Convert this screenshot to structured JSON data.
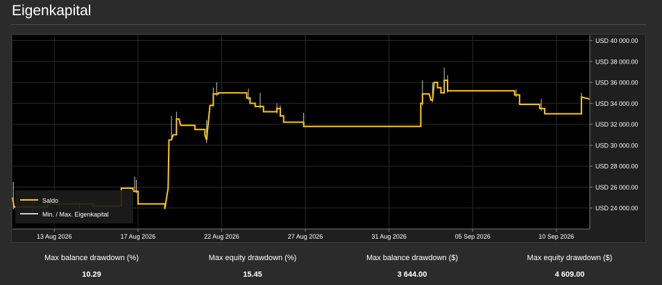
{
  "page": {
    "title": "Eigenkapital"
  },
  "chart_data": {
    "type": "line",
    "title": "Eigenkapital",
    "x_ticks": [
      "13 Aug 2026",
      "17 Aug 2026",
      "22 Aug 2026",
      "27 Aug 2026",
      "31 Aug 2026",
      "05 Sep 2026",
      "10 Sep 2026"
    ],
    "y_ticks": [
      "USD 24 000.00",
      "USD 26 000.00",
      "USD 28 000.00",
      "USD 30 000.00",
      "USD 32 000.00",
      "USD 34 000.00",
      "USD 36 000.00",
      "USD 38 000.00",
      "USD 40 000.00"
    ],
    "ylim": [
      22000,
      40500
    ],
    "xlim": [
      0,
      34.5
    ],
    "grid": true,
    "legend_position": "bottom-left",
    "series": [
      {
        "name": "Saldo",
        "color": "#ffcc00",
        "points": [
          [
            0,
            25000
          ],
          [
            0.1,
            24100
          ],
          [
            2.1,
            24100
          ],
          [
            2.1,
            24400
          ],
          [
            4.8,
            24400
          ],
          [
            4.8,
            24200
          ],
          [
            6.5,
            24200
          ],
          [
            6.5,
            25900
          ],
          [
            7.2,
            25900
          ],
          [
            7.2,
            25600
          ],
          [
            7.5,
            25600
          ],
          [
            7.5,
            24400
          ],
          [
            9.1,
            24400
          ],
          [
            9.1,
            23900
          ],
          [
            9.3,
            25900
          ],
          [
            9.35,
            30500
          ],
          [
            9.5,
            30500
          ],
          [
            9.6,
            31000
          ],
          [
            9.8,
            31000
          ],
          [
            9.8,
            32500
          ],
          [
            9.95,
            32500
          ],
          [
            10.05,
            31900
          ],
          [
            10.9,
            31900
          ],
          [
            10.9,
            31500
          ],
          [
            11.5,
            31500
          ],
          [
            11.5,
            31000
          ],
          [
            11.6,
            30500
          ],
          [
            11.7,
            32200
          ],
          [
            11.8,
            33800
          ],
          [
            12.0,
            33800
          ],
          [
            12.0,
            34900
          ],
          [
            12.3,
            34900
          ],
          [
            12.3,
            35000
          ],
          [
            14.0,
            35000
          ],
          [
            14.0,
            34500
          ],
          [
            14.2,
            34500
          ],
          [
            14.2,
            34000
          ],
          [
            14.5,
            34000
          ],
          [
            14.5,
            33700
          ],
          [
            15.0,
            33700
          ],
          [
            15.0,
            33200
          ],
          [
            15.8,
            33200
          ],
          [
            15.8,
            33500
          ],
          [
            16.0,
            33500
          ],
          [
            16.0,
            32800
          ],
          [
            16.2,
            32800
          ],
          [
            16.2,
            32200
          ],
          [
            17.4,
            32200
          ],
          [
            17.4,
            31800
          ],
          [
            24.4,
            31800
          ],
          [
            24.4,
            34000
          ],
          [
            24.5,
            34000
          ],
          [
            24.5,
            34900
          ],
          [
            24.9,
            34900
          ],
          [
            25.0,
            34300
          ],
          [
            25.1,
            34300
          ],
          [
            25.2,
            36000
          ],
          [
            25.4,
            36000
          ],
          [
            25.4,
            35500
          ],
          [
            25.6,
            35500
          ],
          [
            25.6,
            35000
          ],
          [
            25.8,
            35000
          ],
          [
            25.8,
            36200
          ],
          [
            26.0,
            36200
          ],
          [
            26.0,
            35200
          ],
          [
            30.0,
            35200
          ],
          [
            30.0,
            34800
          ],
          [
            30.3,
            34800
          ],
          [
            30.3,
            33900
          ],
          [
            31.5,
            33900
          ],
          [
            31.5,
            33500
          ],
          [
            31.8,
            33500
          ],
          [
            31.8,
            33000
          ],
          [
            34.0,
            33000
          ],
          [
            34.0,
            34600
          ],
          [
            34.5,
            34400
          ]
        ]
      },
      {
        "name": "Min. / Max. Eigenkapital",
        "color": "#cfcfcf",
        "spikes": [
          [
            0.05,
            23900,
            26500
          ],
          [
            1.2,
            23600,
            24600
          ],
          [
            1.9,
            23800,
            24500
          ],
          [
            2.8,
            24100,
            24700
          ],
          [
            4.0,
            23900,
            24600
          ],
          [
            7.3,
            25500,
            27000
          ],
          [
            7.4,
            25400,
            26700
          ],
          [
            9.5,
            30500,
            32800
          ],
          [
            9.8,
            31000,
            33200
          ],
          [
            11.6,
            30200,
            32400
          ],
          [
            12.0,
            33700,
            35500
          ],
          [
            12.2,
            34700,
            36000
          ],
          [
            14.1,
            34300,
            35400
          ],
          [
            14.8,
            33500,
            35000
          ],
          [
            15.8,
            33000,
            34000
          ],
          [
            16.0,
            32700,
            33800
          ],
          [
            17.4,
            31700,
            33100
          ],
          [
            24.5,
            33800,
            36200
          ],
          [
            25.1,
            34100,
            36000
          ],
          [
            25.8,
            35000,
            37400
          ],
          [
            26.0,
            35000,
            36700
          ],
          [
            30.1,
            34600,
            35300
          ],
          [
            31.6,
            33300,
            34400
          ],
          [
            34.0,
            32900,
            35000
          ]
        ]
      }
    ]
  },
  "stats": [
    {
      "label": "Max balance drawdown (%)",
      "value": "10.29"
    },
    {
      "label": "Max equity drawdown (%)",
      "value": "15.45"
    },
    {
      "label": "Max balance drawdown ($)",
      "value": "3 644.00"
    },
    {
      "label": "Max equity drawdown ($)",
      "value": "4 609.00"
    }
  ]
}
